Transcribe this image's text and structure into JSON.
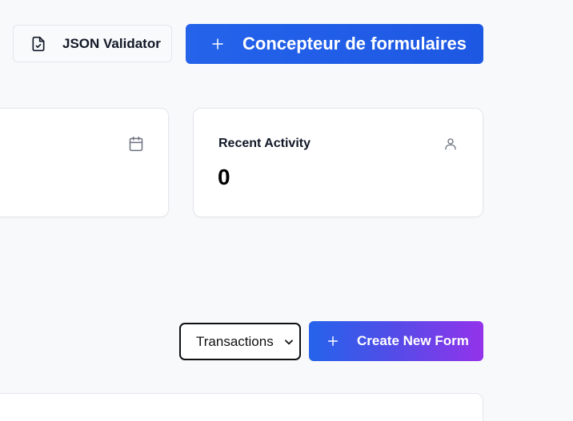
{
  "toolbar": {
    "json_validator_label": "JSON Validator",
    "form_builder_label": "Concepteur de formulaires",
    "icons": {
      "json_validator": "file-check-icon",
      "form_builder": "plus-icon"
    }
  },
  "stats": {
    "left_card": {
      "icon": "calendar-icon"
    },
    "recent_activity": {
      "title": "Recent Activity",
      "value": "0",
      "icon": "user-icon"
    }
  },
  "forms": {
    "filter": {
      "selected": "Transactions",
      "options": [
        "Transactions"
      ]
    },
    "create_label": "Create New Form",
    "create_icon": "plus-icon"
  },
  "colors": {
    "primary": "#2563eb",
    "gradient_end": "#9333ea",
    "background": "#f8f9fb",
    "card_border": "#e3e6ea"
  }
}
